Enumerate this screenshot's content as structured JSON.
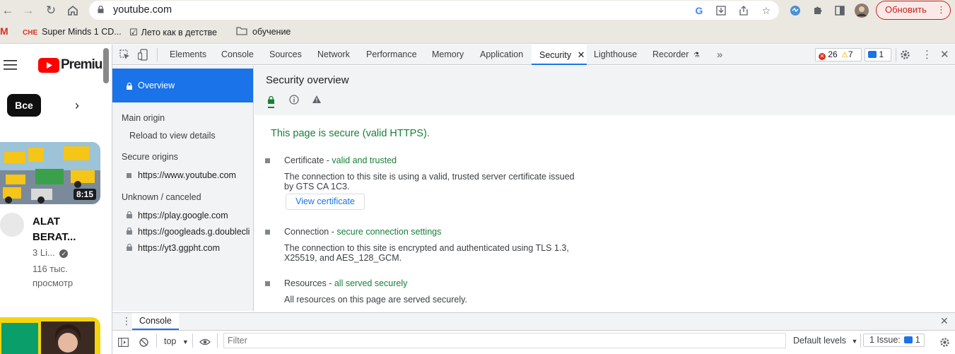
{
  "browser": {
    "url": "youtube.com",
    "update_label": "Обновить",
    "bookmarks": [
      {
        "icon": "gmail-icon",
        "label": ""
      },
      {
        "icon": "che-icon",
        "label": "Super Minds 1 CD..."
      },
      {
        "icon": "checkmark-icon",
        "label": "Лето как в детстве"
      },
      {
        "icon": "folder-icon",
        "label": "обучение"
      }
    ]
  },
  "youtube": {
    "logo_text": "Premiu",
    "chip_all": "Все",
    "video_duration": "8:15",
    "video_title_line1": "ALAT",
    "video_title_line2": "BERAT...",
    "channel": "3 Li...",
    "views_line1": "116 тыс.",
    "views_line2": "просмотр"
  },
  "devtools": {
    "tabs": [
      "Elements",
      "Console",
      "Sources",
      "Network",
      "Performance",
      "Memory",
      "Application",
      "Security",
      "Lighthouse",
      "Recorder"
    ],
    "active_tab": "Security",
    "errors_count": "26",
    "warnings_count": "7",
    "issues_count": "1",
    "sidebar": {
      "overview": "Overview",
      "main_origin_heading": "Main origin",
      "reload_hint": "Reload to view details",
      "secure_origins_heading": "Secure origins",
      "secure_origins": [
        "https://www.youtube.com"
      ],
      "unknown_heading": "Unknown / canceled",
      "unknown_origins": [
        "https://play.google.com",
        "https://googleads.g.doublecli",
        "https://yt3.ggpht.com"
      ]
    },
    "security": {
      "title": "Security overview",
      "summary": "This page is secure (valid HTTPS).",
      "certificate_label": "Certificate",
      "certificate_status": "valid and trusted",
      "certificate_desc_line1": "The connection to this site is using a valid, trusted server certificate issued",
      "certificate_desc_line2": "by GTS CA 1C3.",
      "view_certificate": "View certificate",
      "connection_label": "Connection",
      "connection_status": "secure connection settings",
      "connection_desc_line1": "The connection to this site is encrypted and authenticated using TLS 1.3,",
      "connection_desc_line2": "X25519, and AES_128_GCM.",
      "resources_label": "Resources",
      "resources_status": "all served securely",
      "resources_desc": "All resources on this page are served securely.",
      "separator": " - "
    },
    "drawer": {
      "tab": "Console",
      "context": "top",
      "filter_placeholder": "Filter",
      "levels": "Default levels",
      "issues_label": "1 Issue:",
      "issues_count": "1"
    }
  },
  "colors": {
    "accent": "#1a73e8",
    "secure_green": "#188038",
    "error_red": "#d93025",
    "warning_amber": "#f9ab00"
  }
}
